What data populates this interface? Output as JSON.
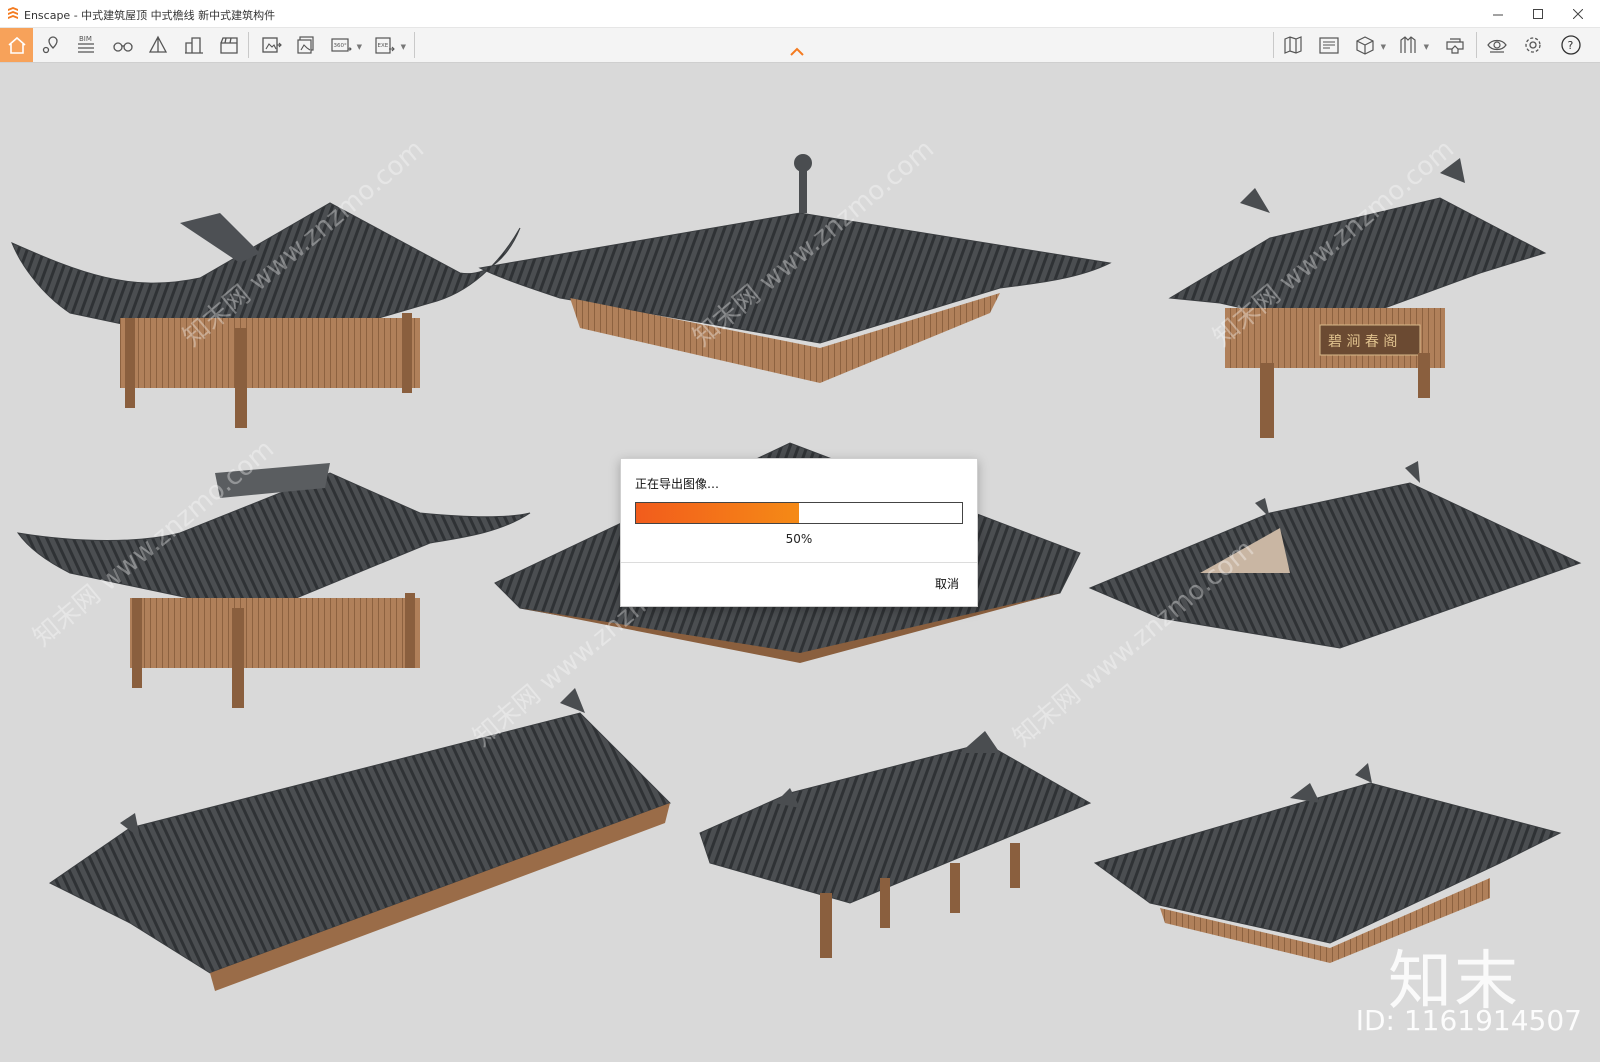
{
  "window": {
    "title": "Enscape - 中式建筑屋顶 中式檐线 新中式建筑构件",
    "controls": [
      "minimize",
      "maximize",
      "close"
    ]
  },
  "toolbar": {
    "left_icons": [
      "home-icon",
      "location-pin-icon",
      "bim-icon",
      "binoculars-icon",
      "perspective-icon",
      "buildings-icon",
      "clapperboard-icon",
      "render-screenshot-icon",
      "batch-render-icon",
      "panorama-360-icon",
      "export-exe-icon"
    ],
    "bim_label": "BIM",
    "pano_label": "360°",
    "exe_label": "EXE",
    "right_icons": [
      "map-icon",
      "asset-library-icon",
      "cube-icon",
      "material-icon",
      "vr-headset-icon",
      "eye-icon",
      "settings-icon",
      "help-icon"
    ],
    "help_label": "?"
  },
  "accent_color": "#f7a25a",
  "progress_color": "#f25c1c",
  "dialog": {
    "message": "正在导出图像…",
    "progress": 0.5,
    "percent_label": "50%",
    "cancel_label": "取消"
  },
  "sign_text": "碧 涧 春 阁",
  "watermark": {
    "repeat_text": "知末网 www.znzmo.com",
    "brand": "知末",
    "image_id": "ID: 1161914507"
  }
}
